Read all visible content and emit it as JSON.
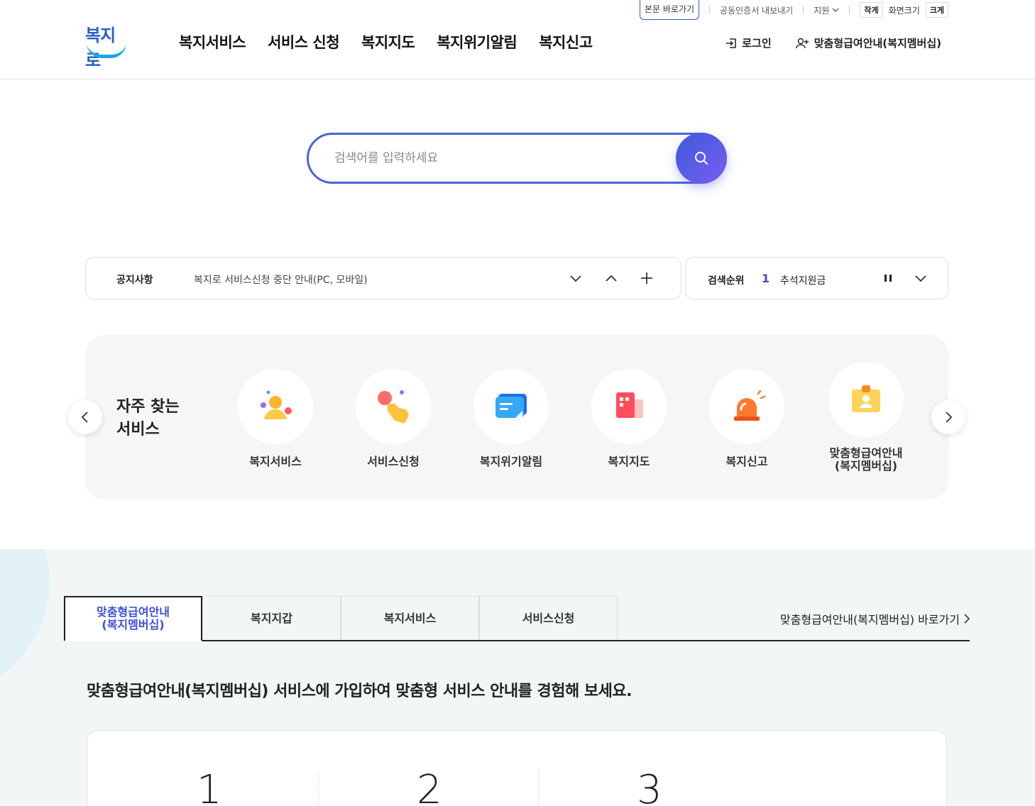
{
  "util": {
    "skip": "본문 바로가기",
    "cert": "공동인증서 내보내기",
    "support": "지원",
    "small": "작게",
    "screen": "화면크기",
    "large": "크게"
  },
  "logo": {
    "text": "복지로"
  },
  "gnb": [
    "복지서비스",
    "서비스 신청",
    "복지지도",
    "복지위기알림",
    "복지신고"
  ],
  "header": {
    "login": "로그인",
    "membership": "맞춤형급여안내(복지멤버십)"
  },
  "search": {
    "placeholder": "검색어를 입력하세요"
  },
  "notice": {
    "title": "공지사항",
    "text": "복지로 서비스신청 중단 안내(PC, 모바일)"
  },
  "rank": {
    "title": "검색순위",
    "num": "1",
    "keyword": "추석지원금"
  },
  "frequent": {
    "heading_line1": "자주 찾는",
    "heading_line2": "서비스",
    "items": [
      {
        "label": "복지서비스",
        "icon": "person-icon"
      },
      {
        "label": "서비스신청",
        "icon": "hand-tap-icon"
      },
      {
        "label": "복지위기알림",
        "icon": "message-icon"
      },
      {
        "label": "복지지도",
        "icon": "map-icon"
      },
      {
        "label": "복지신고",
        "icon": "siren-icon"
      },
      {
        "label": "맞춤형급여안내\n(복지멤버십)",
        "icon": "id-card-icon"
      }
    ]
  },
  "tabs": {
    "items": [
      "맞춤형급여안내\n(복지멤버십)",
      "복지지갑",
      "복지서비스",
      "서비스신청"
    ],
    "active": 0,
    "more": "맞춤형급여안내(복지멤버십) 바로가기"
  },
  "lower": {
    "desc": "맞춤형급여안내(복지멤버십) 서비스에 가입하여 맞춤형 서비스 안내를 경험해 보세요.",
    "steps": [
      "1",
      "2",
      "3"
    ]
  },
  "colors": {
    "accent": "#4a64d6",
    "brand": "#2a5fc4",
    "active_tab": "#3b4fd8"
  }
}
